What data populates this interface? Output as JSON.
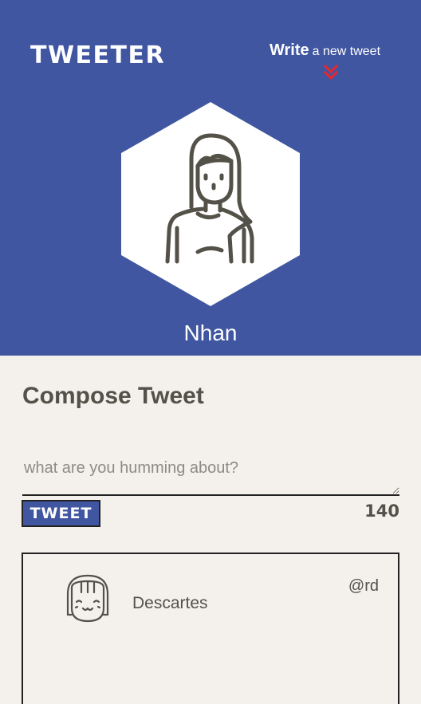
{
  "header": {
    "logo": "TWEETER",
    "write_strong": "Write",
    "write_rest": "a new tweet",
    "chevron_color": "#e8262f",
    "background": "#4056a1",
    "user_name": "Nhan",
    "avatar_icon": "woman-avatar-icon"
  },
  "compose": {
    "title": "Compose Tweet",
    "placeholder": "what are you humming about?",
    "value": "",
    "button_label": "TWEET",
    "char_count": "140"
  },
  "tweets": [
    {
      "name": "Descartes",
      "handle": "@rd",
      "avatar_icon": "girl-avatar-icon"
    }
  ]
}
